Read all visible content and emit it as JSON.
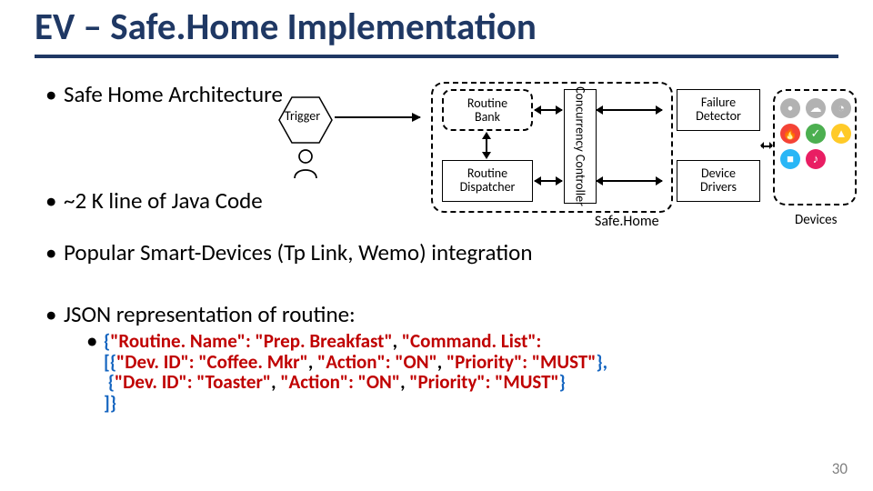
{
  "title": "EV – Safe.Home Implementation",
  "bullets": {
    "b1": "Safe Home Architecture",
    "b2": "~2 K line of Java Code",
    "b3": "Popular Smart-Devices (Tp Link, Wemo) integration",
    "b4": "JSON representation of routine:"
  },
  "diagram": {
    "trigger": "Trigger",
    "routine_bank": "Routine\nBank",
    "routine_dispatcher": "Routine\nDispatcher",
    "concurrency_controller": "Concurrency Controller",
    "failure_detector": "Failure\nDetector",
    "device_drivers": "Device\nDrivers",
    "safehome_label": "Safe.Home",
    "devices_label": "Devices"
  },
  "json_example": {
    "line1a": "{",
    "line1b": "\"Routine. Name\": \"Prep. Breakfast\"",
    "line1c": ", ",
    "line1d": "\"Command. List\":",
    "line2a": "[{",
    "line2b": "\"Dev. ID\": \"Coffee. Mkr\"",
    "line2c": ", ",
    "line2d": "\"Action\": \"ON\"",
    "line2e": ", ",
    "line2f": "\"Priority\": \"MUST\"",
    "line2g": "},",
    "line3a": "{",
    "line3b": "\"Dev. ID\": \"Toaster\"",
    "line3c": ", ",
    "line3d": "\"Action\": \"ON\"",
    "line3e": ", ",
    "line3f": "\"Priority\": \"MUST\"",
    "line3g": "}",
    "line4": "]}"
  },
  "device_icons": [
    {
      "bg": "#b2b2b2",
      "glyph": "•"
    },
    {
      "bg": "#b2b2b2",
      "glyph": "☁"
    },
    {
      "bg": "#b2b2b2",
      "glyph": "◔"
    },
    {
      "bg": "#f44336",
      "glyph": "🔥"
    },
    {
      "bg": "#4caf50",
      "glyph": "✓"
    },
    {
      "bg": "#ffca28",
      "glyph": "▲"
    },
    {
      "bg": "#29b6f6",
      "glyph": "■"
    },
    {
      "bg": "#e91e63",
      "glyph": "♪"
    }
  ],
  "page_number": "30"
}
